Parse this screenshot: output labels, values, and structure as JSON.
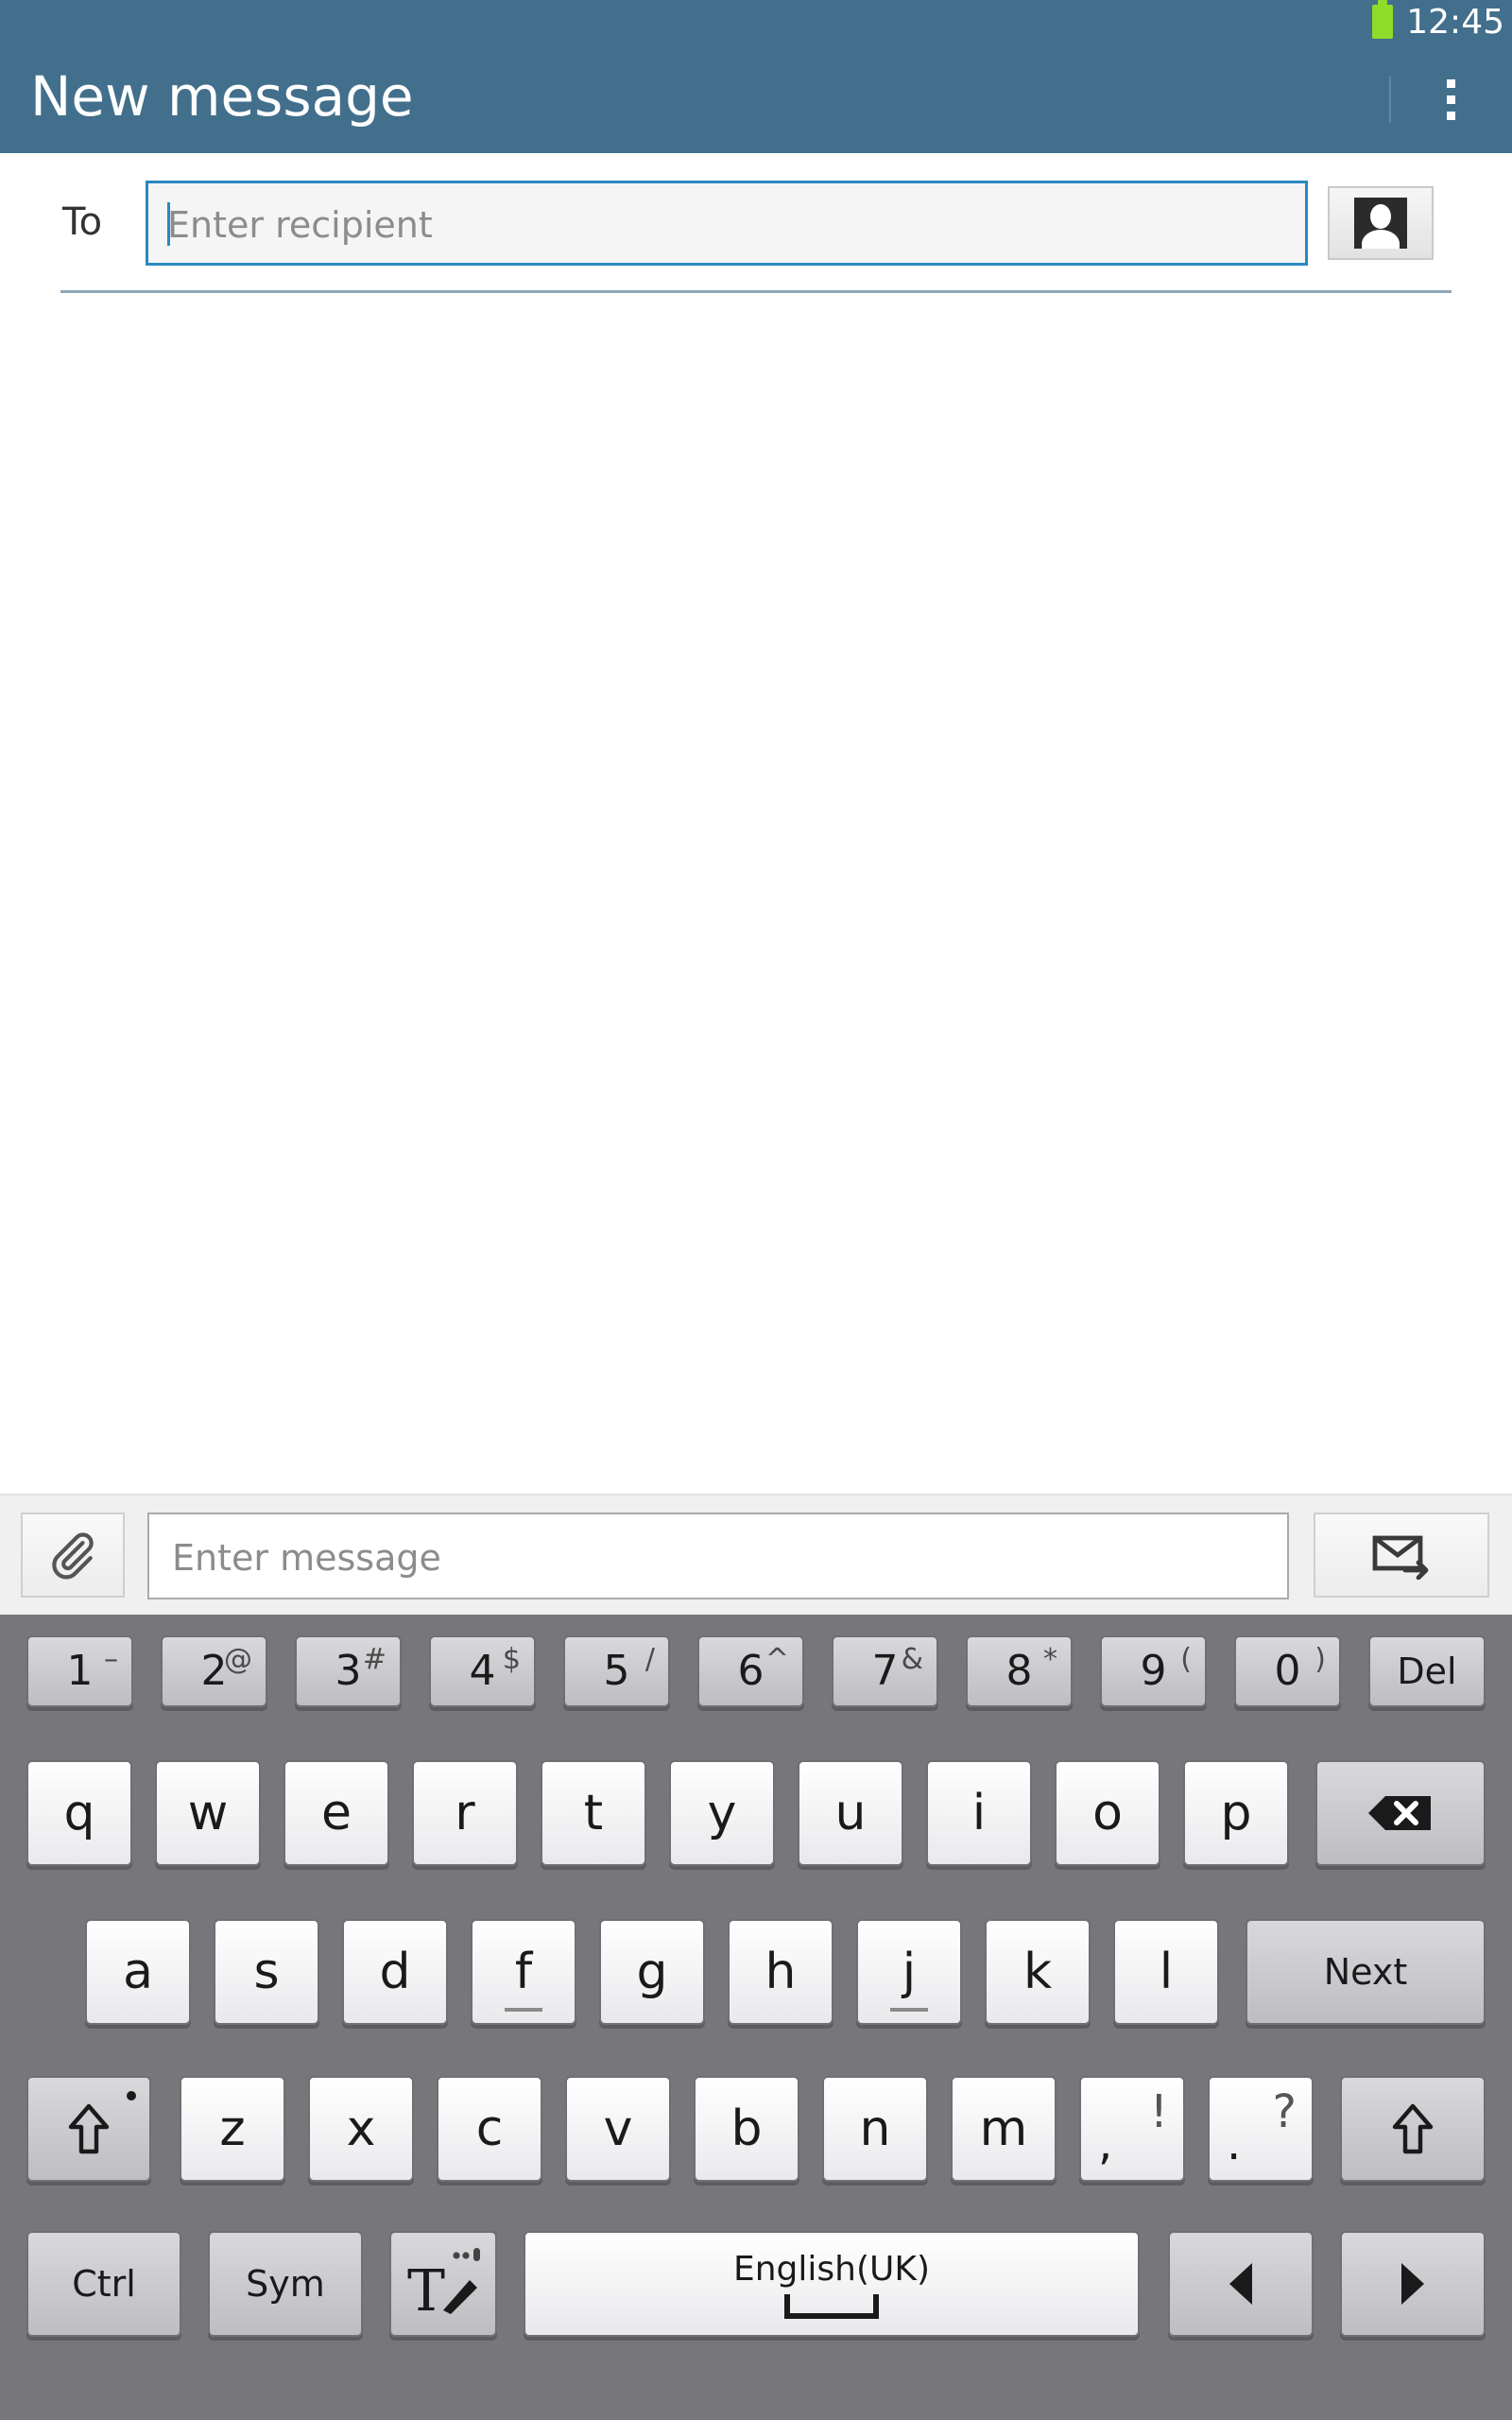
{
  "status_bar": {
    "time": "12:45",
    "battery_color": "#8fdc2a"
  },
  "app_bar": {
    "title": "New message",
    "background": "#426f8c",
    "overflow_icon": "overflow-menu-icon"
  },
  "recipient": {
    "label": "To",
    "placeholder": "Enter recipient",
    "contacts_icon": "contact-icon"
  },
  "compose": {
    "placeholder": "Enter message",
    "attach_icon": "paperclip-icon",
    "send_icon": "send-message-icon"
  },
  "keyboard": {
    "number_row": [
      {
        "main": "1",
        "sup": "–"
      },
      {
        "main": "2",
        "sup": "@"
      },
      {
        "main": "3",
        "sup": "#"
      },
      {
        "main": "4",
        "sup": "$"
      },
      {
        "main": "5",
        "sup": "/"
      },
      {
        "main": "6",
        "sup": "^"
      },
      {
        "main": "7",
        "sup": "&"
      },
      {
        "main": "8",
        "sup": "*"
      },
      {
        "main": "9",
        "sup": "("
      },
      {
        "main": "0",
        "sup": ")"
      }
    ],
    "del_label": "Del",
    "row1": [
      "q",
      "w",
      "e",
      "r",
      "t",
      "y",
      "u",
      "i",
      "o",
      "p"
    ],
    "row2": [
      "a",
      "s",
      "d",
      "f",
      "g",
      "h",
      "j",
      "k",
      "l"
    ],
    "next_label": "Next",
    "row3": [
      "z",
      "x",
      "c",
      "v",
      "b",
      "n",
      "m"
    ],
    "comma_key": {
      "main": ",",
      "sup": "!"
    },
    "period_key": {
      "main": ".",
      "sup": "?"
    },
    "ctrl_label": "Ctrl",
    "sym_label": "Sym",
    "space_label": "English(UK)"
  }
}
